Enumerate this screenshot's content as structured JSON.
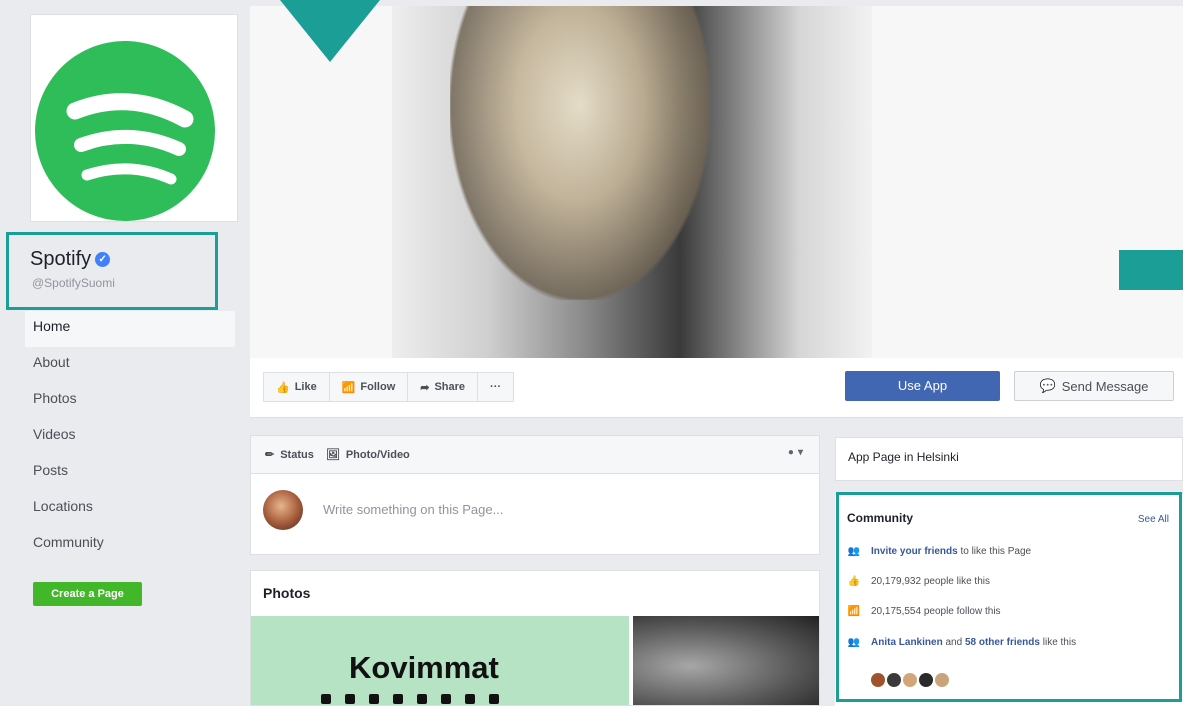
{
  "page": {
    "name": "Spotify",
    "handle": "@SpotifySuomi"
  },
  "sidebar": {
    "items": [
      {
        "label": "Home"
      },
      {
        "label": "About"
      },
      {
        "label": "Photos"
      },
      {
        "label": "Videos"
      },
      {
        "label": "Posts"
      },
      {
        "label": "Locations"
      },
      {
        "label": "Community"
      }
    ],
    "create_page": "Create a Page"
  },
  "actions": {
    "like": "Like",
    "follow": "Follow",
    "share": "Share",
    "more": "···",
    "use_app": "Use App",
    "send_message": "Send Message"
  },
  "composer": {
    "status": "Status",
    "photo_video": "Photo/Video",
    "placeholder": "Write something on this Page..."
  },
  "photos": {
    "title": "Photos",
    "tile_text": "Kovimmat"
  },
  "about_card": {
    "text": "App Page in Helsinki"
  },
  "community": {
    "title": "Community",
    "see_all": "See All",
    "invite_link": "Invite your friends",
    "invite_rest": "to like this Page",
    "likes": "20,179,932 people like this",
    "follows": "20,175,554 people follow this",
    "friend_name": "Anita Lankinen",
    "friends_and": "and",
    "friends_other": "58 other friends",
    "friends_rest": "like this"
  },
  "colors": {
    "highlight": "#1a9e96",
    "spotify_green": "#2ebd59",
    "fb_blue": "#4267b2",
    "create_green": "#42b72a"
  }
}
